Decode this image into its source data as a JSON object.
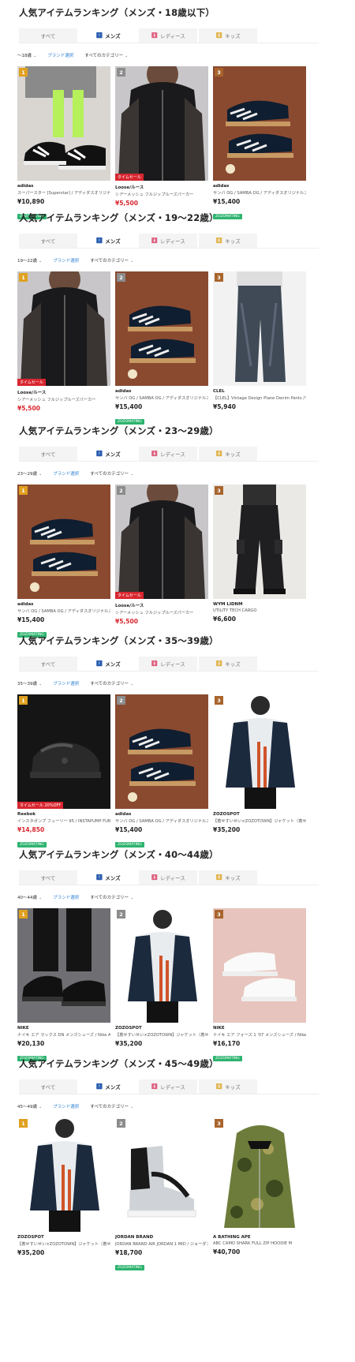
{
  "tabs": {
    "all": "すべて",
    "men": "メンズ",
    "ladies": "レディース",
    "kids": "キッズ"
  },
  "filters": {
    "brand": "ブランド選択",
    "category": "すべてのカテゴリー"
  },
  "sections": [
    {
      "title": "人気アイテムランキング（メンズ・18歳以下）",
      "age_filter": "〜18歳",
      "items": [
        {
          "rank": "1",
          "brand": "adidas",
          "name": "スーパースター [Superstar] / アディダスオリジナ…",
          "price": "¥10,890",
          "sale": false,
          "tag": "",
          "badge": "ZOZOMATING"
        },
        {
          "rank": "2",
          "brand": "Loose/ルース",
          "name": "シアーメッシュ フルジップルーズパーカー",
          "price": "¥5,500",
          "sale": true,
          "tag": "タイムセール",
          "badge": ""
        },
        {
          "rank": "3",
          "brand": "adidas",
          "name": "サンバ OG / SAMBA OG / アディダスオリジナルス …",
          "price": "¥15,400",
          "sale": false,
          "tag": "",
          "badge": "ZOZOMATING"
        }
      ]
    },
    {
      "title": "人気アイテムランキング（メンズ・19〜22歳）",
      "age_filter": "19〜22歳",
      "items": [
        {
          "rank": "1",
          "brand": "Loose/ルース",
          "name": "シアーメッシュ フルジップルーズパーカー",
          "price": "¥5,500",
          "sale": true,
          "tag": "タイムセール",
          "badge": ""
        },
        {
          "rank": "2",
          "brand": "adidas",
          "name": "サンバ OG / SAMBA OG / アディダスオリジナルス …",
          "price": "¥15,400",
          "sale": false,
          "tag": "",
          "badge": "ZOZOMATING"
        },
        {
          "rank": "3",
          "brand": "CLEL",
          "name": "【CLEL】Vintage Design Plane Denim Pants /ヴィ…",
          "price": "¥5,940",
          "sale": false,
          "tag": "",
          "badge": ""
        }
      ]
    },
    {
      "title": "人気アイテムランキング（メンズ・23〜29歳）",
      "age_filter": "23〜29歳",
      "items": [
        {
          "rank": "1",
          "brand": "adidas",
          "name": "サンバ OG / SAMBA OG / アディダスオリジナルス …",
          "price": "¥15,400",
          "sale": false,
          "tag": "",
          "badge": "ZOZOMATING"
        },
        {
          "rank": "2",
          "brand": "Loose/ルース",
          "name": "シアーメッシュ フルジップルーズパーカー",
          "price": "¥5,500",
          "sale": true,
          "tag": "タイムセール",
          "badge": ""
        },
        {
          "rank": "3",
          "brand": "WYM LIDNM",
          "name": "UTILITY TECH CARGO",
          "price": "¥6,600",
          "sale": false,
          "tag": "",
          "badge": ""
        }
      ]
    },
    {
      "title": "人気アイテムランキング（メンズ・35〜39歳）",
      "age_filter": "35〜39歳",
      "items": [
        {
          "rank": "1",
          "brand": "Reebok",
          "name": "インスタポンプ フューリー 95 / INSTAPUMP FURY …",
          "price": "¥14,850",
          "sale": true,
          "tag": "タイムセール 20%OFF",
          "badge": "ZOZOMATING"
        },
        {
          "rank": "2",
          "brand": "adidas",
          "name": "サンバ OG / SAMBA OG / アディダスオリジナルス …",
          "price": "¥15,400",
          "sale": false,
          "tag": "",
          "badge": "ZOZOMATING"
        },
        {
          "rank": "3",
          "brand": "ZOZOSPOT",
          "name": "【着せすいせい×ZOZOTOWN】ジャケット（着せす…",
          "price": "¥35,200",
          "sale": false,
          "tag": "",
          "badge": ""
        }
      ]
    },
    {
      "title": "人気アイテムランキング（メンズ・40〜44歳）",
      "age_filter": "40〜44歳",
      "items": [
        {
          "rank": "1",
          "brand": "NIKE",
          "name": "ナイキ エア マックス DN メンズシューズ / Nike Air …",
          "price": "¥20,130",
          "sale": false,
          "tag": "",
          "badge": "ZOZOMATING"
        },
        {
          "rank": "2",
          "brand": "ZOZOSPOT",
          "name": "【着せすいせい×ZOZOTOWN】ジャケット（着せす…",
          "price": "¥35,200",
          "sale": false,
          "tag": "",
          "badge": ""
        },
        {
          "rank": "3",
          "brand": "NIKE",
          "name": "ナイキ エア フォース 1 '07 メンズシューズ / Nike …",
          "price": "¥16,170",
          "sale": false,
          "tag": "",
          "badge": "ZOZOMATING"
        }
      ]
    },
    {
      "title": "人気アイテムランキング（メンズ・45〜49歳）",
      "age_filter": "45〜49歳",
      "items": [
        {
          "rank": "1",
          "brand": "ZOZOSPOT",
          "name": "【着せすいせい×ZOZOTOWN】ジャケット（着せす…",
          "price": "¥35,200",
          "sale": false,
          "tag": "",
          "badge": ""
        },
        {
          "rank": "2",
          "brand": "JORDAN BRAND",
          "name": "JORDAN BRAND AIR JORDAN 1 MID / ジョーダン…",
          "price": "¥18,700",
          "sale": false,
          "tag": "",
          "badge": "ZOZOMATING"
        },
        {
          "rank": "3",
          "brand": "A BATHING APE",
          "name": "ABC CAMO SHARK FULL ZIP HOODIE M",
          "price": "¥40,700",
          "sale": false,
          "tag": "",
          "badge": ""
        }
      ]
    }
  ]
}
